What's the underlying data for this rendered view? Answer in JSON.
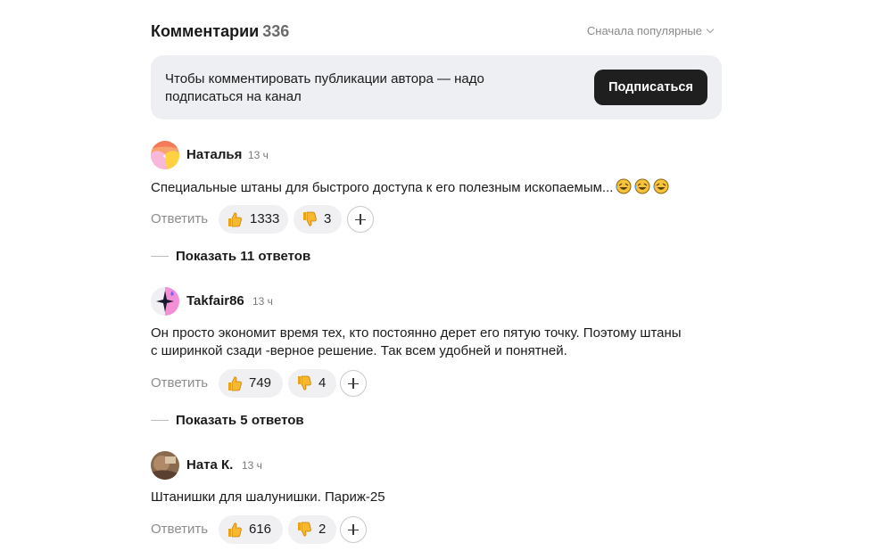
{
  "header": {
    "title": "Комментарии",
    "count": "336",
    "sort_label": "Сначала популярные"
  },
  "subscribe": {
    "text": "Чтобы комментировать публикации автора — надо подписаться на канал",
    "button_label": "Подписаться"
  },
  "comments": [
    {
      "author": "Наталья",
      "time": "13 ч",
      "text": "Специальные штаны для быстрого доступа к его полезным ископаемым...",
      "trailing_emoji": [
        "rolling-on-floor-laughing",
        "rolling-on-floor-laughing",
        "rolling-on-floor-laughing"
      ],
      "reply_label": "Ответить",
      "likes": "1333",
      "dislikes": "3",
      "show_replies": "Показать 11 ответов"
    },
    {
      "author": "Takfair86",
      "time": "13 ч",
      "text_line1": "Он просто экономит время тех, кто постоянно дерет его пятую точку. Поэтому штаны",
      "text_line2": "с ширинкой сзади -верное решение. Так всем удобней и понятней.",
      "reply_label": "Ответить",
      "likes": "749",
      "dislikes": "4",
      "show_replies": "Показать 5 ответов"
    },
    {
      "author": "Ната К.",
      "time": "13 ч",
      "text": "Штанишки для шалунишки. Париж-25",
      "reply_label": "Ответить",
      "likes": "616",
      "dislikes": "2"
    }
  ],
  "icons": {
    "like": "thumbs-up-icon",
    "dislike": "thumbs-down-icon",
    "add": "add-reaction-icon",
    "sort": "chevron-down-icon"
  },
  "colors": {
    "button_bg": "#1f1f1f",
    "banner_bg": "#eeeff2",
    "pill_bg": "#f0f0f2",
    "muted_text": "#8c8c8c"
  }
}
